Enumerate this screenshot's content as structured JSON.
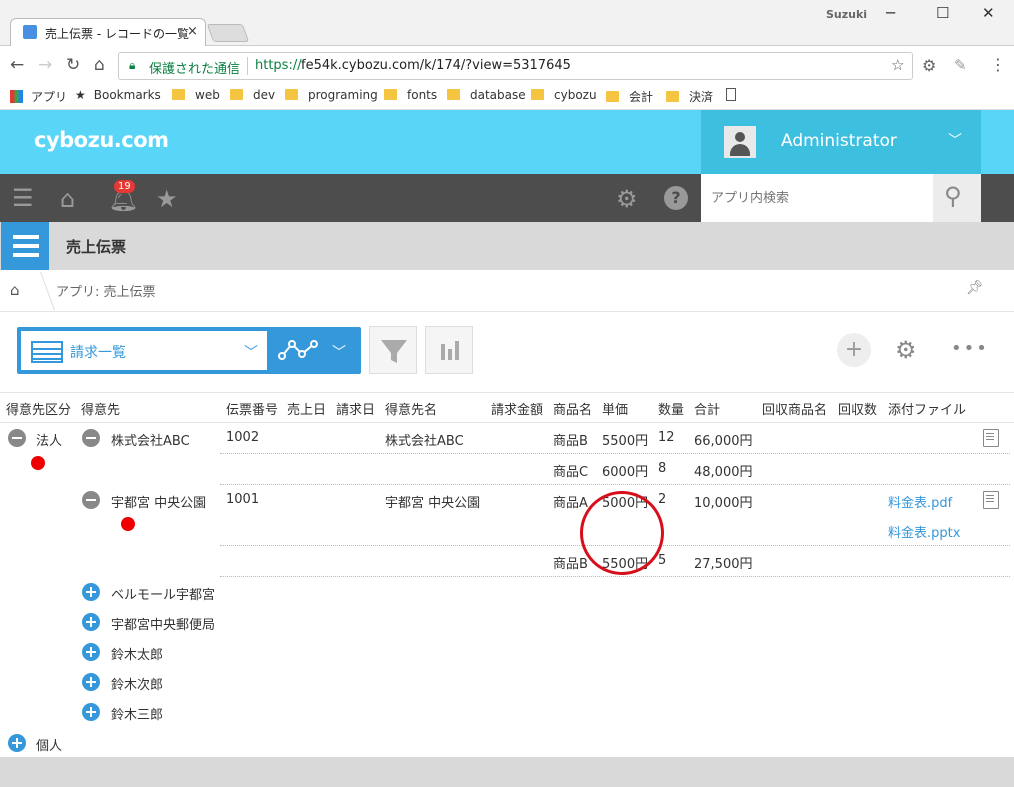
{
  "browser": {
    "tab_title": "売上伝票 - レコードの一覧",
    "tab_close": "×",
    "window_user": "Suzuki",
    "window_min": "─",
    "window_max": "☐",
    "window_close": "✕",
    "secure_label": "保護された通信",
    "url_scheme": "https://",
    "url_rest": "fe54k.cybozu.com/k/174/?view=5317645",
    "bookmarks": [
      {
        "label": "アプリ"
      },
      {
        "label": "Bookmarks"
      },
      {
        "label": "web"
      },
      {
        "label": "dev"
      },
      {
        "label": "programing"
      },
      {
        "label": "fonts"
      },
      {
        "label": "database"
      },
      {
        "label": "cybozu"
      },
      {
        "label": "会計"
      },
      {
        "label": "決済"
      }
    ]
  },
  "header": {
    "logo": "cybozu.com",
    "user_name": "Administrator",
    "notification_count": "19",
    "search_placeholder": "アプリ内検索"
  },
  "app": {
    "title": "売上伝票",
    "breadcrumb": "アプリ: 売上伝票"
  },
  "toolbar": {
    "view_name": "請求一覧",
    "add_label": "+"
  },
  "table": {
    "columns": [
      "得意先区分",
      "得意先",
      "伝票番号",
      "売上日",
      "請求日",
      "得意先名",
      "請求金額",
      "商品名",
      "単価",
      "数量",
      "合計",
      "回収商品名",
      "回収数",
      "添付ファイル"
    ],
    "groups": {
      "corp": "法人",
      "individual": "個人"
    },
    "customers": [
      "株式会社ABC",
      "宇都宮 中央公園",
      "ベルモール宇都宮",
      "宇都宮中央郵便局",
      "鈴木太郎",
      "鈴木次郎",
      "鈴木三郎"
    ],
    "rows": [
      {
        "slip": "1002",
        "customer_name": "株式会社ABC",
        "items": [
          {
            "product": "商品B",
            "price": "5500円",
            "qty": "12",
            "total": "66,000円"
          },
          {
            "product": "商品C",
            "price": "6000円",
            "qty": "8",
            "total": "48,000円"
          }
        ]
      },
      {
        "slip": "1001",
        "customer_name": "宇都宮 中央公園",
        "items": [
          {
            "product": "商品A",
            "price": "5000円",
            "qty": "2",
            "total": "10,000円"
          },
          {
            "product": "商品B",
            "price": "5500円",
            "qty": "5",
            "total": "27,500円"
          }
        ],
        "files": [
          "料金表.pdf",
          "料金表.pptx"
        ]
      }
    ]
  },
  "colors": {
    "header_bg": "#58d5f7",
    "nav_bg": "#4d4d4d",
    "accent": "#3498db",
    "annotation": "#d70f1b"
  }
}
